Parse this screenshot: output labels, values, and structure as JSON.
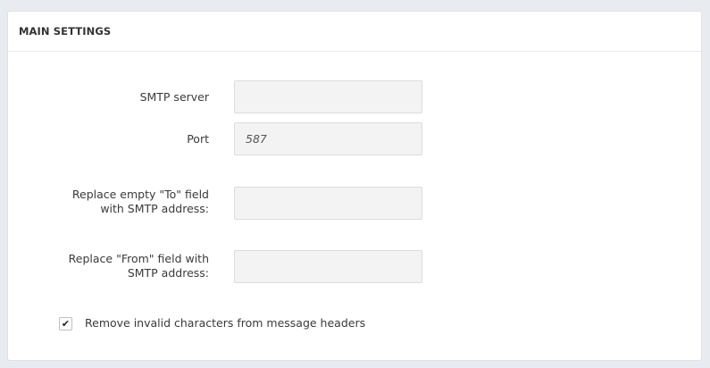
{
  "section": {
    "title": "MAIN SETTINGS"
  },
  "fields": {
    "smtp_server": {
      "label": "SMTP server",
      "value": ""
    },
    "port": {
      "label": "Port",
      "value": "587"
    },
    "replace_to": {
      "label_line1": "Replace empty \"To\" field",
      "label_line2": "with SMTP address:",
      "value": ""
    },
    "replace_from": {
      "label_line1": "Replace \"From\" field with",
      "label_line2": "SMTP address:",
      "value": ""
    }
  },
  "options": {
    "remove_invalid": {
      "label": "Remove invalid characters from message headers",
      "checked": true,
      "check_glyph": "✔"
    }
  }
}
